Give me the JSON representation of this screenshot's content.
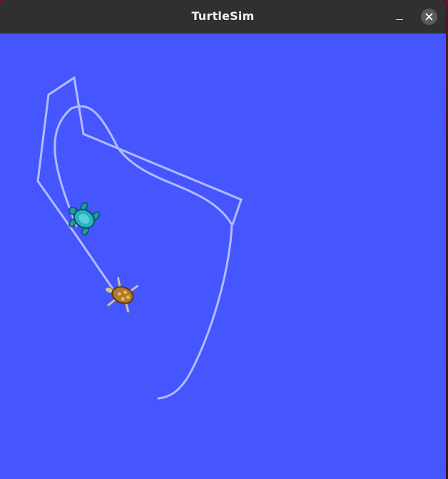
{
  "window": {
    "title": "TurtleSim"
  },
  "colors": {
    "background": "#4556ff",
    "pen": "#b4bbff",
    "titlebar": "#303030"
  },
  "icons": {
    "minimize": "minimize-icon",
    "close": "close-icon",
    "turtle_1": "turtle-icon",
    "turtle_2": "turtle-icon"
  }
}
